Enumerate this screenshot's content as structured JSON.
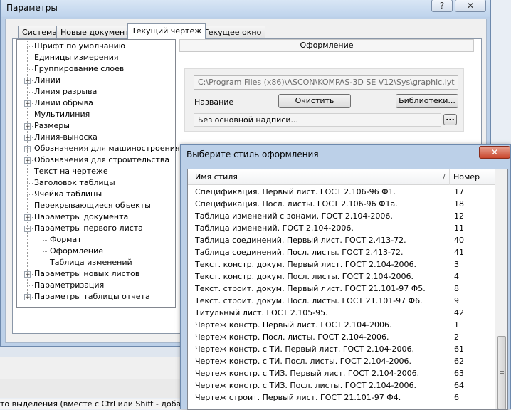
{
  "window": {
    "title": "Параметры",
    "help": "?",
    "close": "✕"
  },
  "tabs": [
    "Система",
    "Новые документы",
    "Текущий чертеж",
    "Текущее окно"
  ],
  "tree": [
    {
      "label": "Шрифт по умолчанию",
      "expandable": false,
      "level": 0
    },
    {
      "label": "Единицы измерения",
      "expandable": false,
      "level": 0
    },
    {
      "label": "Группирование слоев",
      "expandable": false,
      "level": 0
    },
    {
      "label": "Линии",
      "expandable": true,
      "level": 0
    },
    {
      "label": "Линия разрыва",
      "expandable": false,
      "level": 0
    },
    {
      "label": "Линии обрыва",
      "expandable": true,
      "level": 0
    },
    {
      "label": "Мультилиния",
      "expandable": false,
      "level": 0
    },
    {
      "label": "Размеры",
      "expandable": true,
      "level": 0
    },
    {
      "label": "Линия-выноска",
      "expandable": true,
      "level": 0
    },
    {
      "label": "Обозначения для машиностроения",
      "expandable": true,
      "level": 0
    },
    {
      "label": "Обозначения для строительства",
      "expandable": true,
      "level": 0
    },
    {
      "label": "Текст на чертеже",
      "expandable": false,
      "level": 0
    },
    {
      "label": "Заголовок таблицы",
      "expandable": false,
      "level": 0
    },
    {
      "label": "Ячейка таблицы",
      "expandable": false,
      "level": 0
    },
    {
      "label": "Перекрывающиеся объекты",
      "expandable": false,
      "level": 0
    },
    {
      "label": "Параметры документа",
      "expandable": true,
      "level": 0
    },
    {
      "label": "Параметры первого листа",
      "expandable": true,
      "expanded": true,
      "level": 0
    },
    {
      "label": "Формат",
      "expandable": false,
      "level": 1
    },
    {
      "label": "Оформление",
      "expandable": false,
      "level": 1
    },
    {
      "label": "Таблица изменений",
      "expandable": false,
      "level": 1
    },
    {
      "label": "Параметры новых листов",
      "expandable": true,
      "level": 0
    },
    {
      "label": "Параметризация",
      "expandable": false,
      "level": 0
    },
    {
      "label": "Параметры таблицы отчета",
      "expandable": true,
      "level": 0
    }
  ],
  "right": {
    "section_title": "Оформление",
    "path": "C:\\Program Files (x86)\\ASCON\\KOMPAS-3D SE V12\\Sys\\graphic.lyt",
    "name_label": "Название",
    "clear_button": "Очистить",
    "libraries_button": "Библиотеки...",
    "style_value": "Без основной надписи...",
    "browse_button": "..."
  },
  "popup": {
    "title": "Выберите стиль оформления",
    "close": "✕",
    "col_name": "Имя стиля",
    "col_sep": "/",
    "col_num": "Номер",
    "rows": [
      {
        "name": "Спецификация. Первый лист. ГОСТ 2.106-96 Ф1.",
        "num": "17"
      },
      {
        "name": "Спецификация. Посл. листы. ГОСТ 2.106-96 Ф1а.",
        "num": "18"
      },
      {
        "name": "Таблица изменений с зонами. ГОСТ 2.104-2006.",
        "num": "12"
      },
      {
        "name": "Таблица изменений. ГОСТ 2.104-2006.",
        "num": "11"
      },
      {
        "name": "Таблица соединений. Первый лист. ГОСТ 2.413-72.",
        "num": "40"
      },
      {
        "name": "Таблица соединений. Посл. листы. ГОСТ 2.413-72.",
        "num": "41"
      },
      {
        "name": "Текст. констр. докум. Первый лист. ГОСТ 2.104-2006.",
        "num": "3"
      },
      {
        "name": "Текст. констр. докум. Посл. листы. ГОСТ 2.104-2006.",
        "num": "4"
      },
      {
        "name": "Текст. строит. докум. Первый лист. ГОСТ 21.101-97 Ф5.",
        "num": "8"
      },
      {
        "name": "Текст. строит. докум. Посл. листы. ГОСТ 21.101-97 Ф6.",
        "num": "9"
      },
      {
        "name": "Титульный лист. ГОСТ 2.105-95.",
        "num": "42"
      },
      {
        "name": "Чертеж констр. Первый лист. ГОСТ 2.104-2006.",
        "num": "1"
      },
      {
        "name": "Чертеж констр. Посл. листы. ГОСТ 2.104-2006.",
        "num": "2"
      },
      {
        "name": "Чертеж констр. с ТИ. Первый лист. ГОСТ 2.104-2006.",
        "num": "61"
      },
      {
        "name": "Чертеж констр. с ТИ. Посл. листы. ГОСТ 2.104-2006.",
        "num": "62"
      },
      {
        "name": "Чертеж констр. с ТИЗ. Первый лист. ГОСТ 2.104-2006.",
        "num": "63"
      },
      {
        "name": "Чертеж констр. с ТИЗ. Посл. листы. ГОСТ 2.104-2006.",
        "num": "64"
      },
      {
        "name": "Чертеж строит. Первый лист. ГОСТ 21.101-97 Ф4.",
        "num": "6"
      }
    ]
  },
  "status_text": "то выделения (вместе с Ctrl или Shift - добав"
}
